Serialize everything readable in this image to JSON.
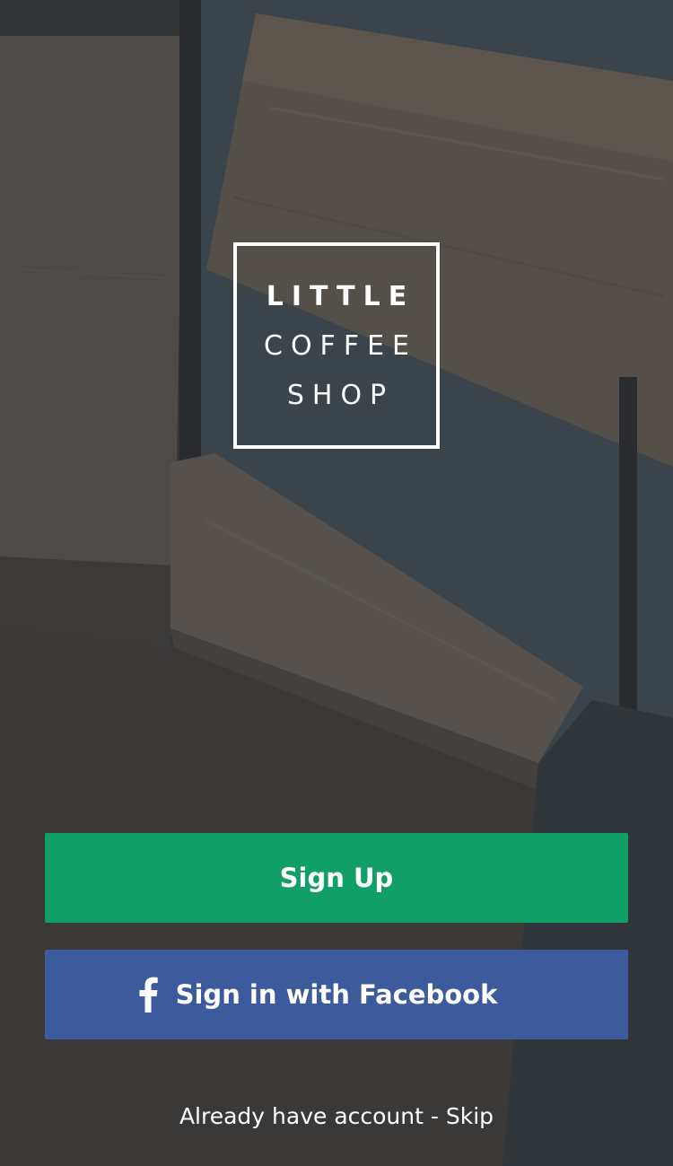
{
  "logo": {
    "line1": "LITTLE",
    "line2": "COFFEE",
    "line3": "SHOP"
  },
  "buttons": {
    "signup_label": "Sign Up",
    "facebook_label": "Sign in with Facebook",
    "facebook_icon": "facebook-f-icon"
  },
  "footer": {
    "account_text": "Already have account",
    "separator": " - ",
    "skip_label": "Skip"
  },
  "colors": {
    "signup": "#10a067",
    "facebook": "#3c5a9c",
    "text": "#ffffff"
  }
}
